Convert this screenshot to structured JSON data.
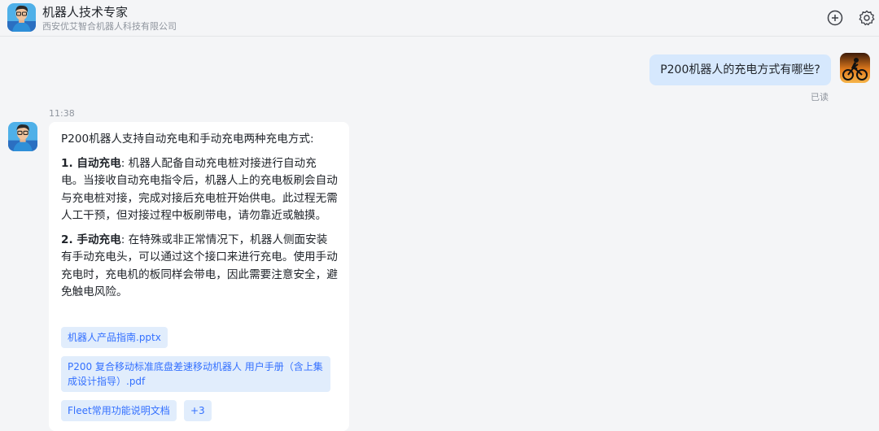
{
  "header": {
    "title": "机器人技术专家",
    "subtitle": "西安优艾智合机器人科技有限公司",
    "add_icon": "plus-circle-icon",
    "settings_icon": "gear-icon"
  },
  "conversation": {
    "user_message": "P200机器人的充电方式有哪些?",
    "read_status": "已读",
    "timestamp": "11:38",
    "bot_reply": {
      "intro": "P200机器人支持自动充电和手动充电两种充电方式:",
      "item1_title": "1. 自动充电",
      "item1_body": ": 机器人配备自动充电桩对接进行自动充电。当接收自动充电指令后，机器人上的充电板刷会自动与充电桩对接，完成对接后充电桩开始供电。此过程无需人工干预，但对接过程中板刷带电，请勿靠近或触摸。",
      "item2_title": "2. 手动充电",
      "item2_body": ": 在特殊或非正常情况下，机器人侧面安装有手动充电头，可以通过这个接口来进行充电。使用手动充电时，充电机的板同样会带电，因此需要注意安全，避免触电风险。"
    },
    "attachments": [
      "机器人产品指南.pptx",
      "P200 复合移动标准底盘差速移动机器人 用户手册（含上集成设计指导）.pdf",
      "Fleet常用功能说明文档",
      "+3"
    ]
  },
  "colors": {
    "accent": "#3370ff",
    "user_bubble": "#d6e8fd",
    "chip_bg": "#e1edfc",
    "background": "#f4f5f7"
  }
}
